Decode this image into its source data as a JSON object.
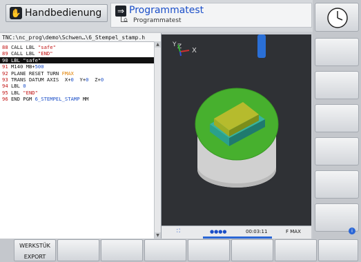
{
  "header": {
    "left_mode_label": "Handbedienung",
    "right_mode_title": "Programmatest",
    "right_mode_subtitle": "Programmatest"
  },
  "program": {
    "path": "TNC:\\nc_prog\\demo\\Schwen…\\6_Stempel_stamp.h",
    "lines": [
      {
        "n": "88",
        "tokens": [
          {
            "t": "CALL LBL ",
            "c": "kw"
          },
          {
            "t": "\"safe\"",
            "c": "str"
          }
        ]
      },
      {
        "n": "89",
        "tokens": [
          {
            "t": "CALL LBL ",
            "c": "kw"
          },
          {
            "t": "\"END\"",
            "c": "str"
          }
        ]
      },
      {
        "n": "90",
        "tokens": [
          {
            "t": "LBL ",
            "c": "kw"
          },
          {
            "t": "\"safe\"",
            "c": "str"
          }
        ],
        "selected": true
      },
      {
        "n": "91",
        "tokens": [
          {
            "t": "M140 MB+",
            "c": "kw"
          },
          {
            "t": "500",
            "c": "num"
          }
        ]
      },
      {
        "n": "92",
        "tokens": [
          {
            "t": "PLANE RESET TURN ",
            "c": "kw"
          },
          {
            "t": "FMAX",
            "c": "fmax"
          }
        ]
      },
      {
        "n": "93",
        "tokens": [
          {
            "t": "TRANS DATUM AXIS  X+",
            "c": "kw"
          },
          {
            "t": "0",
            "c": "num"
          },
          {
            "t": "  Y+",
            "c": "kw"
          },
          {
            "t": "0",
            "c": "num"
          },
          {
            "t": "  Z+",
            "c": "kw"
          },
          {
            "t": "0",
            "c": "num"
          }
        ]
      },
      {
        "n": "94",
        "tokens": [
          {
            "t": "LBL ",
            "c": "kw"
          },
          {
            "t": "0",
            "c": "num"
          }
        ]
      },
      {
        "n": "95",
        "tokens": [
          {
            "t": "LBL ",
            "c": "kw"
          },
          {
            "t": "\"END\"",
            "c": "str"
          }
        ]
      },
      {
        "n": "96",
        "tokens": [
          {
            "t": "END PGM ",
            "c": "kw"
          },
          {
            "t": "6_STEMPEL_STAMP",
            "c": "num"
          },
          {
            "t": " MM",
            "c": "kw"
          }
        ]
      }
    ]
  },
  "view": {
    "axis_y": "Y",
    "axis_z": "Z",
    "axis_x": "X"
  },
  "status": {
    "time": "00:03:11",
    "feed": "F MAX",
    "dots": "●●●●"
  },
  "softkeys": [
    {
      "line1": "WERKSTÜK",
      "line2": "EXPORT"
    },
    {
      "line1": "",
      "line2": ""
    },
    {
      "line1": "",
      "line2": ""
    },
    {
      "line1": "",
      "line2": ""
    },
    {
      "line1": "",
      "line2": ""
    },
    {
      "line1": "",
      "line2": ""
    },
    {
      "line1": "",
      "line2": ""
    },
    {
      "line1": "",
      "line2": ""
    }
  ],
  "icons": {
    "hand": "hand-icon",
    "program_test": "program-test-icon",
    "clock": "clock-icon",
    "info": "info-icon"
  },
  "colors": {
    "accent_blue": "#1a4ec8",
    "line_number_red": "#c01010",
    "fmax_orange": "#e08000",
    "view_bg": "#2f3135"
  }
}
